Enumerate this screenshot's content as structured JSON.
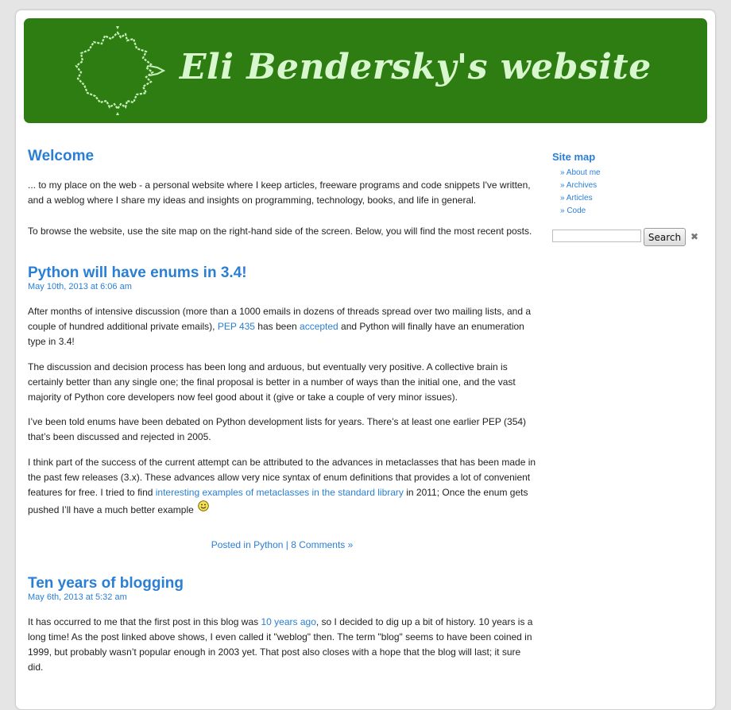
{
  "header": {
    "title": "Eli Bendersky's website"
  },
  "welcome": {
    "title": "Welcome",
    "intro1": "... to my place on the web - a personal website where I keep articles, freeware programs and code snippets I've written, and a weblog where I share my ideas and insights on programming, technology, books, and life in general.",
    "intro2": "To browse the website, use the site map on the right-hand side of the screen. Below, you will find the most recent posts."
  },
  "post1": {
    "title": "Python will have enums in 3.4!",
    "date": "May 10th, 2013 at 6:06 am",
    "p1_a": "After months of intensive discussion (more than a 1000 emails in dozens of threads spread over two mailing lists, and a couple of hundred additional private emails), ",
    "p1_link1": "PEP 435",
    "p1_b": " has been ",
    "p1_link2": "accepted",
    "p1_c": " and Python will finally have an enumeration type in 3.4!",
    "p2": "The discussion and decision process has been long and arduous, but eventually very positive. A collective brain is certainly better than any single one; the final proposal is better in a number of ways than the initial one, and the vast majority of Python core developers now feel good about it (give or take a couple of very minor issues).",
    "p3": "I’ve been told enums have been debated on Python development lists for years. There’s at least one earlier PEP (354) that’s been discussed and rejected in 2005.",
    "p4_a": "I think part of the success of the current attempt can be attributed to the advances in metaclasses that has been made in the past few releases (3.x). These advances allow very nice syntax of enum definitions that provides a lot of convenient features for free. I tried to find ",
    "p4_link": "interesting examples of metaclasses in the standard library",
    "p4_b": " in 2011; Once the enum gets pushed I’ll have a much better example ",
    "meta_posted": "Posted in ",
    "meta_category": "Python",
    "meta_sep": " | ",
    "meta_comments": "8 Comments »"
  },
  "post2": {
    "title": "Ten years of blogging",
    "date": "May 6th, 2013 at 5:32 am",
    "p1_a": "It has occurred to me that the first post in this blog was ",
    "p1_link": "10 years ago",
    "p1_b": ", so I decided to dig up a bit of history. 10 years is a long time! As the post linked above shows, I even called it \"weblog\" then. The term \"blog\" seems to have been coined in 1999, but probably wasn’t popular enough in 2003 yet. That post also closes with a hope that the blog will last; it sure did."
  },
  "sidebar": {
    "title": "Site map",
    "items": [
      "» About me",
      "» Archives",
      "» Articles",
      "» Code"
    ],
    "search_button": "Search",
    "search_value": ""
  },
  "colors": {
    "header_bg": "#2e7d13",
    "title_text": "#d9f7cf",
    "link": "#2a7fd4"
  },
  "icons": {
    "logo": "mandelbrot-fractal-icon",
    "smiley": "smiley-icon",
    "clear": "clear-icon"
  }
}
